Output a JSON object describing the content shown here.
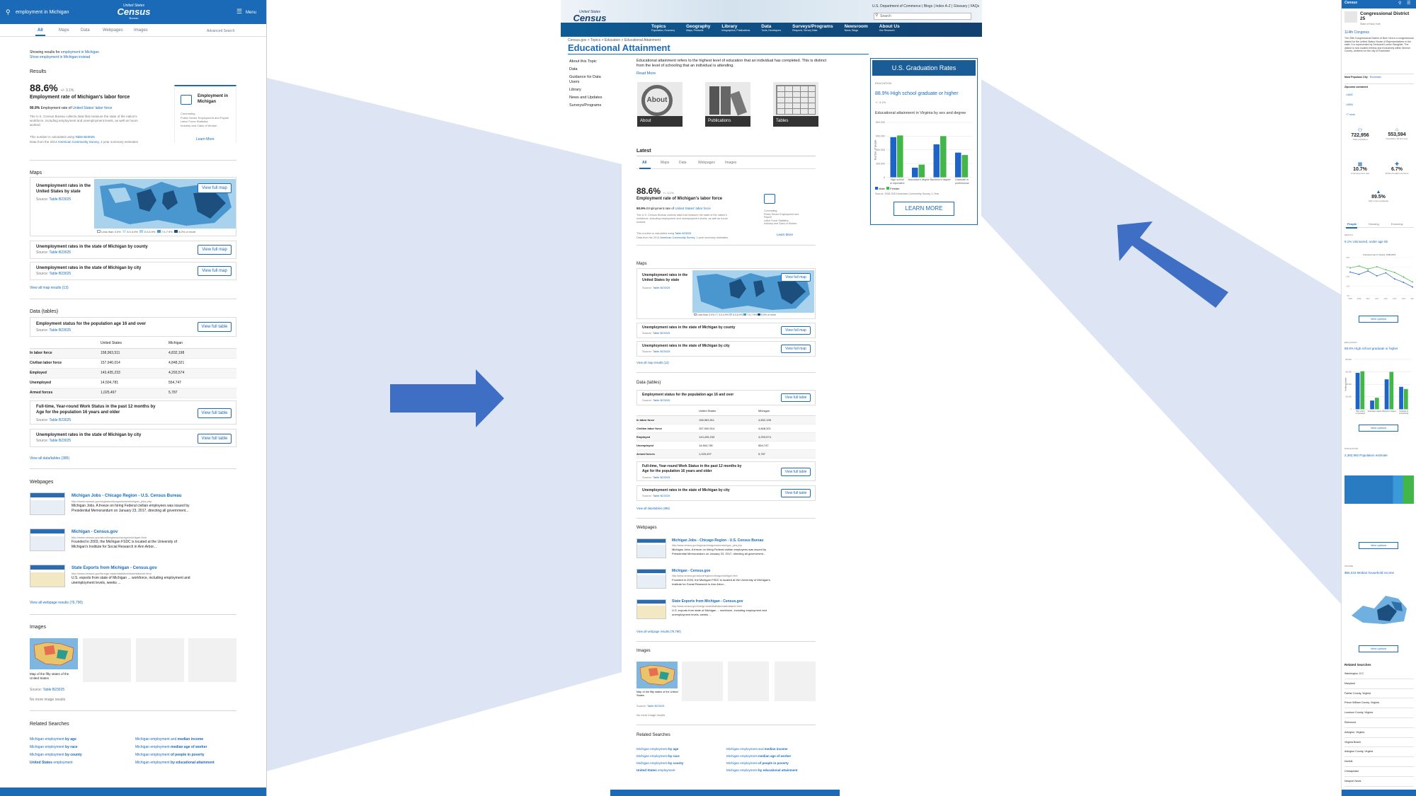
{
  "colors": {
    "brand": "#1a6ab8",
    "arrow": "#3f6fc4",
    "wedge": "#dde5f4",
    "map_light": "#a9d3ec",
    "map_mid": "#4a97cf",
    "map_dark": "#1c4f7d",
    "bar_blue": "#1e63c8",
    "bar_green": "#43b649"
  },
  "left": {
    "search_value": "employment in Michigan",
    "logo": {
      "top": "United States",
      "main": "Census",
      "sub": "Bureau"
    },
    "menu_label": "Menu",
    "tabs": [
      "All",
      "Maps",
      "Data",
      "Webpages",
      "Images"
    ],
    "advanced": "Advanced Search",
    "results_heading": "Results",
    "showing": "Showing results for",
    "showing_query": "employment in Michigan",
    "instead": "Show employment in Michigan instead",
    "stat": {
      "value": "88.6%",
      "moe": "+/- 3.1%",
      "title": "Employment rate of Michigan's labor force",
      "sub_pct": "90.9%",
      "sub_text": "Employment rate of",
      "sub_link": "United States' labor force",
      "desc": "The U.S. Census Bureau collects data that measure the state of the nation's workforce, including employment and unemployment levels, as well as hours worked.",
      "calc": "This number is calculated using",
      "calc_link": "Table B23025",
      "source": "Data from the 2014",
      "source_link": "American Community Survey",
      "source_tail": ", 1-year summary estimates"
    },
    "card": {
      "title": "Employment in Michigan",
      "items": [
        "Commuting",
        "Public Sector Employment and Payroll",
        "Labor Force Statistics",
        "Industry and Class of Worker"
      ],
      "learn": "Learn More"
    },
    "maps_heading": "Maps",
    "map1_title": "Unemployment rates in the United States by state",
    "source_label": "Source:",
    "table_link": "Table B23025",
    "view_map": "View full map",
    "legend": [
      "Less than 3.0%",
      "3.0-4.9%",
      "5.0-6.9%",
      "7.0-7.9%",
      "8.0% or more"
    ],
    "map2_title": "Unemployment rates in the state of Michigan by county",
    "map3_title": "Unemployment rates in the state of Michigan by city",
    "view_all_maps": "View all map results (13)",
    "data_heading": "Data (tables)",
    "table_title": "Employment status for the population age 16 and over",
    "view_table": "View full table",
    "table_cols": [
      "",
      "United States",
      "Michigan"
    ],
    "table_rows": [
      [
        "In labor force",
        "158,963,511",
        "4,832,198"
      ],
      [
        "Civilian labor force",
        "157,940,014",
        "4,848,321"
      ],
      [
        "Employed",
        "143,435,233",
        "4,293,574"
      ],
      [
        "Unemployed",
        "14,504,781",
        "554,747"
      ],
      [
        "Armed forces",
        "1,025,497",
        "5,787"
      ]
    ],
    "data2_title": "Full-time, Year-round Work Status in the past 12 months by Age for the population 16 years and older",
    "data3_title": "Unemployment rates in the state of Michigan by city",
    "view_all_data": "View all data/tables (385)",
    "web_heading": "Webpages",
    "webpages": [
      {
        "title": "Michigan Jobs - Chicago Region - U.S. Census Bureau",
        "url": "http://www.census.gov/regions/chicago/www/michigan_jobs.php",
        "desc": "Michigan Jobs. A freeze on hiring Federal civilian employees was issued by Presidential Memorandum on January 23, 2017, directing all government..."
      },
      {
        "title": "Michigan - Census.gov",
        "url": "http://www.census.gov/about/regions/chicago/michigan.html",
        "desc": "Founded in 2003, the Michigan FSDC is located at the University of Michigan's Institute for Social Research in Ann Arbor..."
      },
      {
        "title": "State Exports from Michigan - Census.gov",
        "url": "http://www.census.gov/foreign-trade/statistics/state/data/mi.html",
        "desc": "U.S. exports from state of Michigan ... workforce, including employment and unemployment levels, weeks ..."
      }
    ],
    "view_all_web": "View all webpage results (76,790)",
    "images_heading": "Images",
    "image_caption": "Map of the fifty states of the United States",
    "no_more": "No more image results",
    "related_heading": "Related Searches",
    "related": [
      [
        "Michigan employment ",
        "by age"
      ],
      [
        "Michigan employment and ",
        "median income"
      ],
      [
        "Michigan employment ",
        "by race"
      ],
      [
        "Michigan employment ",
        "median age of worker"
      ],
      [
        "Michigan employment ",
        "by county"
      ],
      [
        "Michigan employment ",
        "of people in poverty"
      ],
      [
        "United States",
        " employment"
      ],
      [
        "Michigan employment ",
        "by educational attainment"
      ]
    ]
  },
  "middle": {
    "top_links": "U.S. Department of Commerce | Blogs | Index A-Z | Glossary | FAQs",
    "search_placeholder": "Search",
    "nav": [
      {
        "label": "Topics",
        "sub": "Population, Economy"
      },
      {
        "label": "Geography",
        "sub": "Maps, Products"
      },
      {
        "label": "Library",
        "sub": "Infographics, Publications"
      },
      {
        "label": "Data",
        "sub": "Tools, Developers"
      },
      {
        "label": "Surveys/Programs",
        "sub": "Respond, Survey Data"
      },
      {
        "label": "Newsroom",
        "sub": "News, Blogs"
      },
      {
        "label": "About Us",
        "sub": "Our Research"
      }
    ],
    "breadcrumb": "Census.gov > Topics > Education > Educational Attainment",
    "page_title": "Educational Attainment",
    "side_nav": [
      "About this Topic",
      "Data",
      "Guidance for Data Users",
      "Library",
      "News and Updates",
      "Surveys/Programs"
    ],
    "intro": "Educational attainment refers to the highest level of education that an individual has completed. This is distinct from the level of schooling that an individual is attending.",
    "read_more": "Read More",
    "tiles": [
      "About",
      "Publications",
      "Tables"
    ],
    "about_word": "About",
    "latest_heading": "Latest",
    "grad": {
      "header": "U.S. Graduation Rates",
      "category": "EDUCATION",
      "title": "88.9% High school graduate or higher",
      "moe": "+/- 3.1%",
      "chart_title": "Educational attainment in Virginia by sex and degree",
      "learn": "LEARN MORE",
      "legend": [
        "Male",
        "Female"
      ],
      "source": "Source: 2006-2010 American Community Survey, 1-Year"
    }
  },
  "right": {
    "title": "Congressional District 25",
    "subtitle": "State of New York",
    "congress": "114th Congress",
    "desc": "The 25th Congressional District of New York is a congressional district for the United States House of Representatives in the state. It is represented by Democrat Louise Slaughter. The district is now located entirely and exclusively within Monroe County, centered on the city of Rochester.",
    "populous_label": "Most Populous City",
    "populous_value": "Rochester",
    "zip_label": "Zipcodes contained",
    "zips": [
      "14602",
      "14604",
      "+7 more"
    ],
    "stats": [
      {
        "v": "722,956",
        "l": "Total population"
      },
      {
        "v": "553,594",
        "l": "Population 18 and over"
      },
      {
        "v": "10.7%",
        "l": "Unemployment rate"
      },
      {
        "v": "6.7%",
        "l": "Without health insurance"
      },
      {
        "v": "89.5%",
        "l": "High school graduate"
      }
    ],
    "tabs": [
      "People",
      "Housing",
      "Economy"
    ],
    "health_cat": "HEALTH",
    "health_title": "9.1% Uninsured, under age 65",
    "edu_cat": "EDUCATION",
    "edu_title": "88.9% High school graduate or higher",
    "pop_cat": "POPULATION",
    "pop_title": "2,382,992 Population estimate",
    "inc_cat": "INCOME",
    "inc_title": "$65,015 Median household income",
    "view_options": "View options",
    "related_heading": "Related Searches",
    "related": [
      "Washington, D.C.",
      "Maryland",
      "Fairfax County, Virginia",
      "Prince William County, Virginia",
      "Loudoun County, Virginia",
      "Richmond",
      "Arlington, Virginia",
      "Virginia Beach",
      "Arlington County, Virginia",
      "Norfolk",
      "Chesapeake",
      "Newport News"
    ]
  },
  "chart_data": [
    {
      "type": "bar",
      "title": "Educational attainment in Virginia by sex and degree",
      "categories": [
        "High school or equivalent",
        "Associate's degree",
        "Bachelor's degree",
        "Graduate or professional"
      ],
      "series": [
        {
          "name": "Male",
          "values": [
            585000,
            140000,
            480000,
            360000
          ]
        },
        {
          "name": "Female",
          "values": [
            610000,
            185000,
            600000,
            325000
          ]
        }
      ],
      "ylim": [
        0,
        800000
      ],
      "ylabel": "Number of people",
      "legend": "bottom-left"
    },
    {
      "type": "line",
      "title": "Uninsured rate in Virginia, 2008-2015",
      "x": [
        "2008",
        "2009",
        "2010",
        "2011",
        "2012",
        "2013",
        "2014",
        "2015"
      ],
      "series": [
        {
          "name": "Virginia",
          "values": [
            14.2,
            13.6,
            14.5,
            13.2,
            14.0,
            12.4,
            11.5,
            10.3
          ]
        },
        {
          "name": "United States",
          "values": [
            15.3,
            15.8,
            15.0,
            15.6,
            14.8,
            14.1,
            12.9,
            11.6
          ]
        }
      ]
    }
  ]
}
